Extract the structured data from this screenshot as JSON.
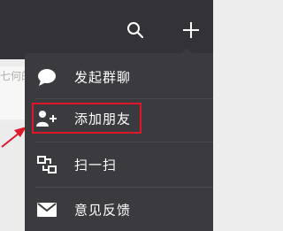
{
  "app": {
    "accent_color": "#e0162b",
    "topbar_color": "#323237",
    "menu_color": "#3a3a3f"
  },
  "topbar": {
    "search_icon": "search-icon",
    "add_icon": "plus-icon"
  },
  "background": {
    "snippet_text": "七何的"
  },
  "menu": {
    "items": [
      {
        "label": "发起群聊",
        "icon": "chat-bubble-icon"
      },
      {
        "label": "添加朋友",
        "icon": "add-friend-icon"
      },
      {
        "label": "扫一扫",
        "icon": "scan-icon"
      },
      {
        "label": "意见反馈",
        "icon": "envelope-icon"
      }
    ]
  }
}
